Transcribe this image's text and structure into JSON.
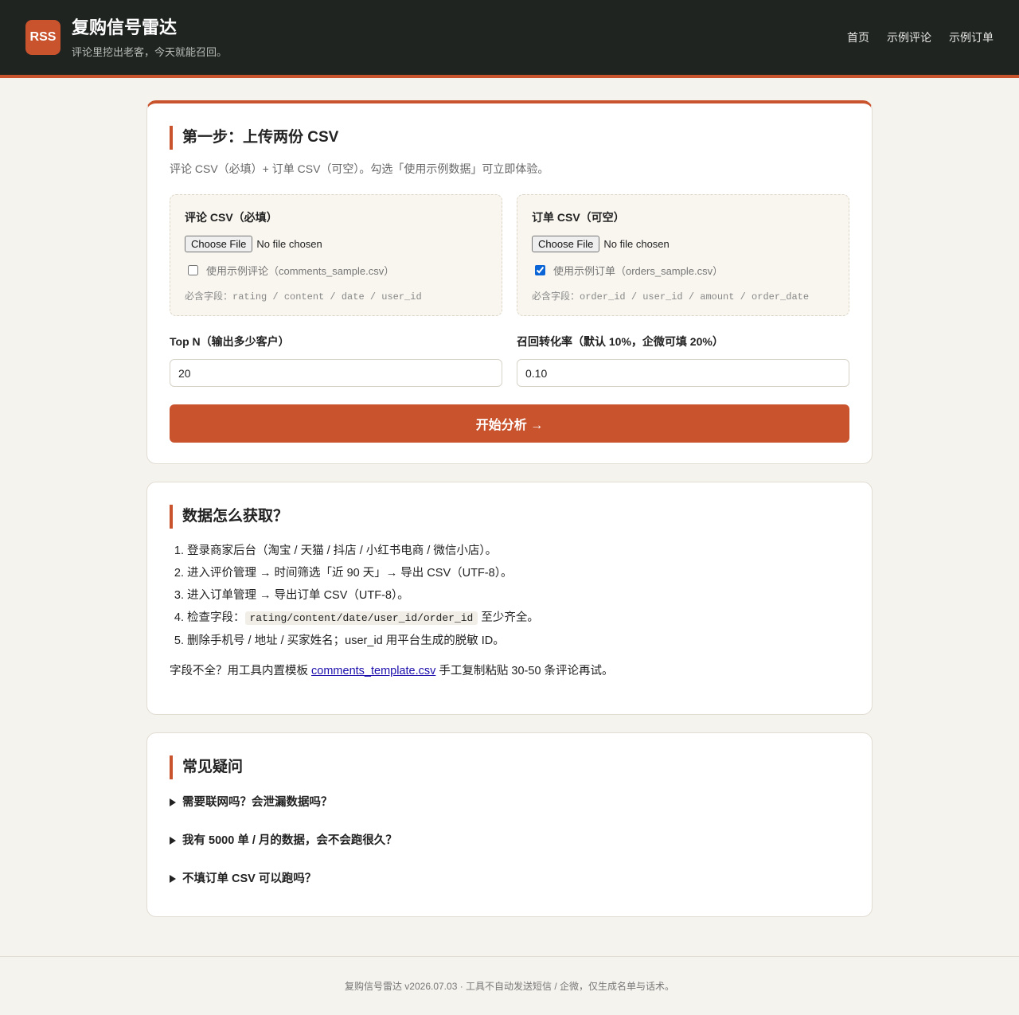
{
  "header": {
    "logo_text": "RSS",
    "title": "复购信号雷达",
    "subtitle": "评论里挖出老客，今天就能召回。",
    "nav": [
      "首页",
      "示例评论",
      "示例订单"
    ]
  },
  "upload_card": {
    "title": "第一步：上传两份 CSV",
    "desc": "评论 CSV（必填）+ 订单 CSV（可空）。勾选「使用示例数据」可立即体验。",
    "comments": {
      "label": "评论 CSV（必填）",
      "choose_file": "Choose File",
      "file_status": "No file chosen",
      "sample_label": "使用示例评论（comments_sample.csv）",
      "sample_checked": false,
      "fields_prefix": "必含字段：",
      "fields": "rating / content / date / user_id"
    },
    "orders": {
      "label": "订单 CSV（可空）",
      "choose_file": "Choose File",
      "file_status": "No file chosen",
      "sample_label": "使用示例订单（orders_sample.csv）",
      "sample_checked": true,
      "fields_prefix": "必含字段：",
      "fields": "order_id / user_id / amount / order_date"
    },
    "top_n": {
      "label": "Top N（输出多少客户）",
      "value": "20"
    },
    "conversion": {
      "label": "召回转化率（默认 10%，企微可填 20%）",
      "value": "0.10"
    },
    "submit_label": "开始分析 →"
  },
  "data_card": {
    "title": "数据怎么获取？",
    "steps": {
      "s1": "登录商家后台（淘宝 / 天猫 / 抖店 / 小红书电商 / 微信小店）。",
      "s2": "进入评价管理 → 时间筛选「近 90 天」→ 导出 CSV（UTF-8）。",
      "s3": "进入订单管理 → 导出订单 CSV（UTF-8）。",
      "s4_prefix": "检查字段：",
      "s4_code": "rating/content/date/user_id/order_id",
      "s4_suffix": "至少齐全。",
      "s5": "删除手机号 / 地址 / 买家姓名；user_id 用平台生成的脱敏 ID。"
    },
    "note_prefix": "字段不全？用工具内置模板 ",
    "note_link": "comments_template.csv",
    "note_suffix": " 手工复制粘贴 30-50 条评论再试。"
  },
  "faq_card": {
    "title": "常见疑问",
    "items": [
      "需要联网吗？会泄漏数据吗？",
      "我有 5000 单 / 月的数据，会不会跑很久？",
      "不填订单 CSV 可以跑吗？"
    ]
  },
  "footer": {
    "text": "复购信号雷达 v2026.07.03 · 工具不自动发送短信 / 企微，仅生成名单与话术。"
  }
}
